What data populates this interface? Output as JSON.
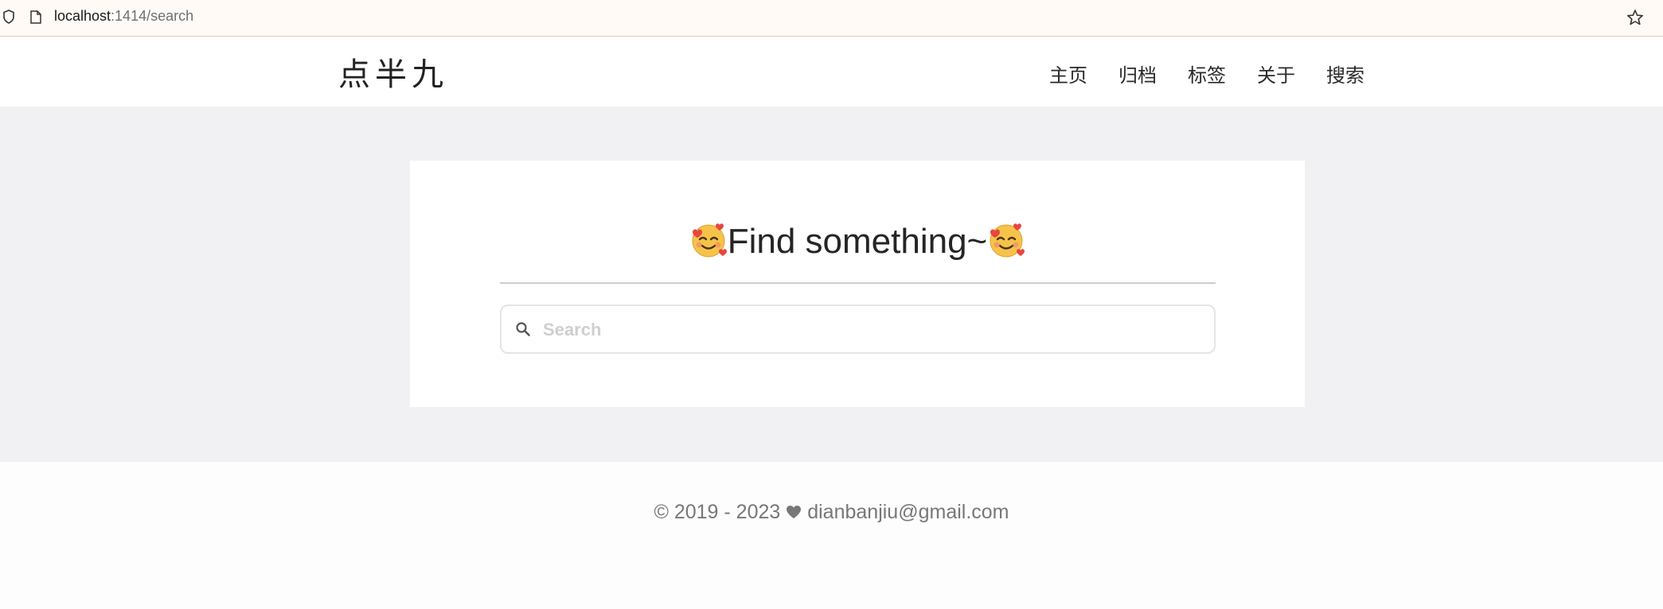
{
  "browser": {
    "url_host": "localhost",
    "url_path": ":1414/search"
  },
  "header": {
    "logo": "点半九",
    "nav": [
      {
        "label": "主页"
      },
      {
        "label": "归档"
      },
      {
        "label": "标签"
      },
      {
        "label": "关于"
      },
      {
        "label": "搜索"
      }
    ]
  },
  "main": {
    "title": "Find something~",
    "title_icon": "smiling-face-with-hearts-icon",
    "search": {
      "placeholder": "Search",
      "value": ""
    }
  },
  "footer": {
    "prefix": "© 2019 - 2023",
    "email": "dianbanjiu@gmail.com"
  },
  "colors": {
    "page_bg": "#f1f1f3",
    "card_bg": "#ffffff",
    "urlbar_bg": "#fffaf6",
    "face": "#f6c34a",
    "heart": "#e8453c"
  }
}
